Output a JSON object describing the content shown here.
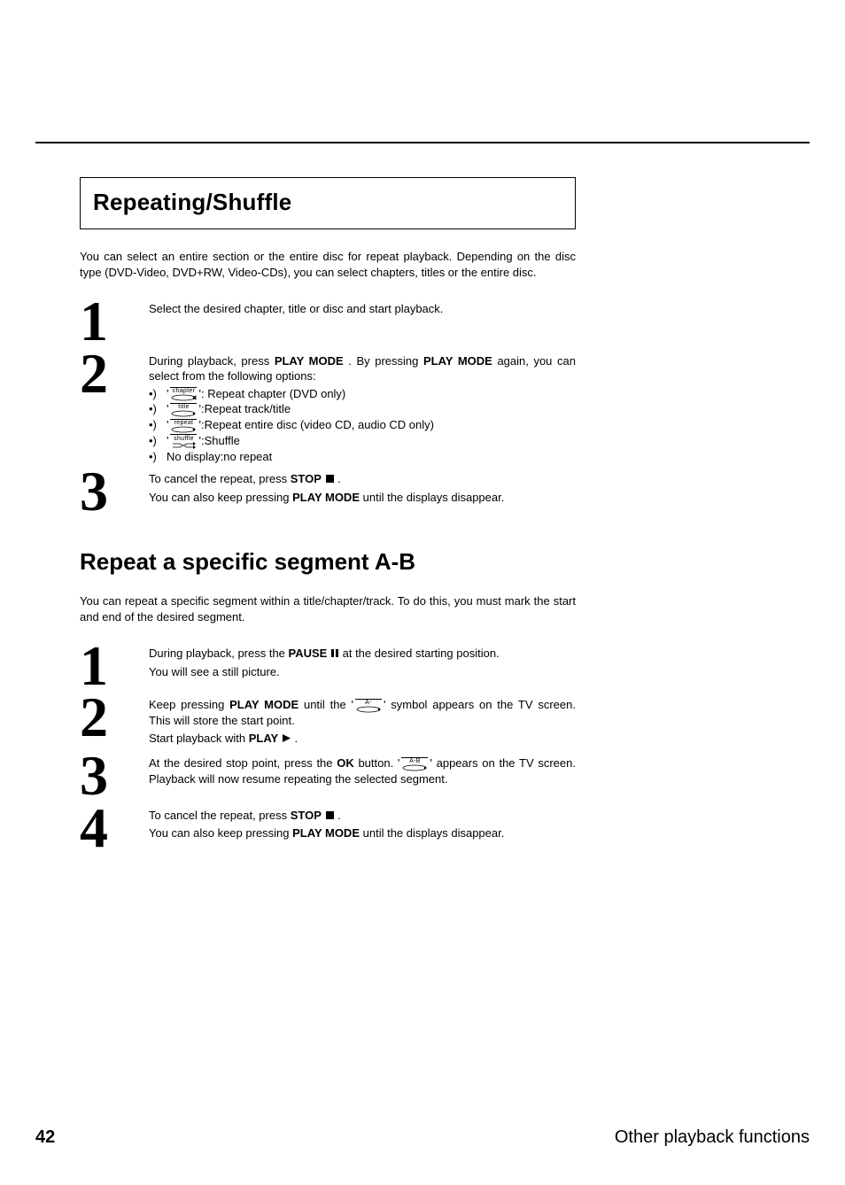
{
  "sections": {
    "repeating": {
      "heading": "Repeating/Shuffle",
      "intro": "You can select an entire section or the entire disc for repeat playback. Depending on the disc type (DVD-Video, DVD+RW, Video-CDs), you can select chapters, titles or the entire disc.",
      "steps": [
        {
          "num": "1",
          "paras": [
            "Select the desired chapter, title or disc and start playback."
          ]
        },
        {
          "num": "2",
          "lead_pre": "During playback, press ",
          "lead_btn1": "PLAY MODE",
          "lead_mid": " . By pressing ",
          "lead_btn2": "PLAY MODE",
          "lead_post": " again, you can select from the following options:",
          "opts": [
            {
              "icon_label": "chapter",
              "text": "': Repeat chapter (DVD only)"
            },
            {
              "icon_label": "title",
              "text": "':Repeat track/title"
            },
            {
              "icon_label": "repeat",
              "text": "':Repeat entire disc (video CD, audio CD only)"
            },
            {
              "icon_label": "shuffle",
              "text": "':Shuffle"
            }
          ],
          "opt_no_icon": "No display:no repeat"
        },
        {
          "num": "3",
          "cancel_pre": "To cancel the repeat, press ",
          "cancel_btn": "STOP",
          "cancel_post": " .",
          "also_pre": "You can also keep pressing ",
          "also_btn": "PLAY MODE",
          "also_post": " until the displays disappear."
        }
      ]
    },
    "ab": {
      "heading": "Repeat a specific segment A-B",
      "intro": "You can repeat a specific segment within a title/chapter/track. To do this, you must mark the start and end of the desired segment.",
      "steps": [
        {
          "num": "1",
          "p1_pre": "During playback, press the ",
          "p1_btn": "PAUSE",
          "p1_post": " at the desired starting position.",
          "p2": "You will see a still picture."
        },
        {
          "num": "2",
          "p1_pre": "Keep pressing ",
          "p1_btn": "PLAY MODE",
          "p1_mid": " until the '",
          "icon_label": "A-",
          "p1_post": "' symbol appears on the TV screen. This will store the start point.",
          "p2_pre": "Start playback with ",
          "p2_btn": "PLAY",
          "p2_post": " ."
        },
        {
          "num": "3",
          "p1_pre": "At the desired stop point, press the ",
          "p1_btn": "OK",
          "p1_mid": " button. '",
          "icon_label": "A-B",
          "p1_post": "' appears on the TV screen. Playback will now resume repeating the selected segment."
        },
        {
          "num": "4",
          "cancel_pre": "To cancel the repeat, press ",
          "cancel_btn": "STOP",
          "cancel_post": " .",
          "also_pre": "You can also keep pressing ",
          "also_btn": "PLAY MODE",
          "also_post": " until the displays disappear."
        }
      ]
    }
  },
  "footer": {
    "page": "42",
    "title": "Other playback functions"
  },
  "bullet": "•) "
}
